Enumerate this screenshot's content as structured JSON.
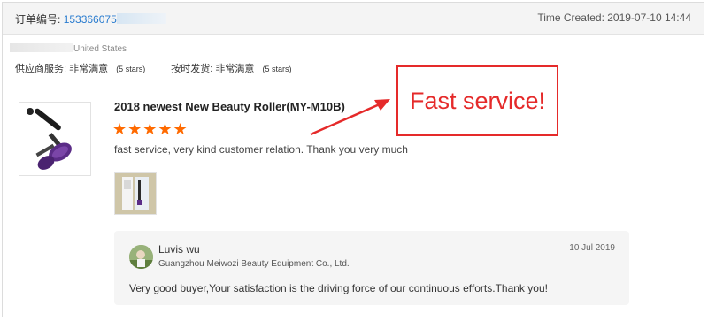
{
  "order": {
    "label": "订单编号:",
    "number_visible": "153366075",
    "time_created": "Time Created: 2019-07-10 14:44"
  },
  "buyer": {
    "location_visible": "United States"
  },
  "ratings": [
    {
      "label": "供应商服务:",
      "value": "非常满意",
      "note": "(5 stars)"
    },
    {
      "label": "按时发货:",
      "value": "非常满意",
      "note": "(5 stars)"
    }
  ],
  "product": {
    "title": "2018 newest New Beauty Roller(MY-M10B)",
    "stars": "★★★★★",
    "rating": 5,
    "feedback": "fast service, very kind customer relation. Thank you very much"
  },
  "annotation": {
    "text": "Fast service!",
    "color": "#e52a2a"
  },
  "seller_reply": {
    "name": "Luvis wu",
    "company": "Guangzhou Meiwozi Beauty Equipment Co., Ltd.",
    "date": "10 Jul 2019",
    "text": "Very good buyer,Your satisfaction is the driving force of our continuous efforts.Thank you!"
  },
  "colors": {
    "link": "#2a7ccf",
    "star": "#ff6a00",
    "accent_red": "#e52a2a"
  }
}
